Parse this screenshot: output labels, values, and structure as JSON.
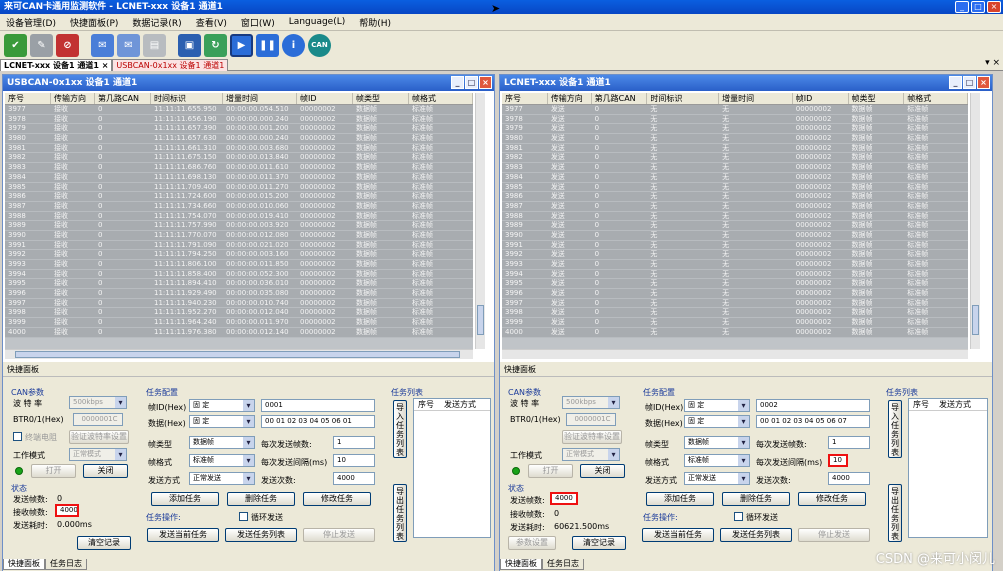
{
  "window": {
    "title": "来可CAN卡通用监测软件 - LCNET-xxx 设备1 通道1"
  },
  "menu": [
    "设备管理(D)",
    "快捷面板(P)",
    "数据记录(R)",
    "查看(V)",
    "窗口(W)",
    "Language(L)",
    "帮助(H)"
  ],
  "toolbar_icons": [
    "check-icon",
    "erase-icon",
    "stop-icon",
    "send-icon",
    "send-all-icon",
    "print-icon",
    "save-icon",
    "refresh-icon",
    "play-icon",
    "pause-icon",
    "info-icon",
    "can-logo-icon"
  ],
  "doc_tabs": [
    {
      "label": "LCNET-xxx 设备1 通道1"
    },
    {
      "label": "USBCAN-0x1xx 设备1 通道1"
    }
  ],
  "columns_left": [
    "序号",
    "传输方向",
    "第几路CAN",
    "时间标识",
    "增量时间",
    "帧ID",
    "帧类型",
    "帧格式"
  ],
  "columns_right": [
    "序号",
    "传输方向",
    "第几路CAN",
    "时间标识",
    "增量时间",
    "帧ID",
    "帧类型",
    "帧格式"
  ],
  "left": {
    "title": "USBCAN-0x1xx 设备1 通道1",
    "rows": [
      [
        "3977",
        "接收",
        "0",
        "11:11:11.655.950",
        "00:00:00.054.510",
        "00000002",
        "数据帧",
        "标准帧"
      ],
      [
        "3978",
        "接收",
        "0",
        "11:11:11.656.190",
        "00:00:00.000.240",
        "00000002",
        "数据帧",
        "标准帧"
      ],
      [
        "3979",
        "接收",
        "0",
        "11:11:11.657.390",
        "00:00:00.001.200",
        "00000002",
        "数据帧",
        "标准帧"
      ],
      [
        "3980",
        "接收",
        "0",
        "11:11:11.657.630",
        "00:00:00.000.240",
        "00000002",
        "数据帧",
        "标准帧"
      ],
      [
        "3981",
        "接收",
        "0",
        "11:11:11.661.310",
        "00:00:00.003.680",
        "00000002",
        "数据帧",
        "标准帧"
      ],
      [
        "3982",
        "接收",
        "0",
        "11:11:11.675.150",
        "00:00:00.013.840",
        "00000002",
        "数据帧",
        "标准帧"
      ],
      [
        "3983",
        "接收",
        "0",
        "11:11:11.686.760",
        "00:00:00.011.610",
        "00000002",
        "数据帧",
        "标准帧"
      ],
      [
        "3984",
        "接收",
        "0",
        "11:11:11.698.130",
        "00:00:00.011.370",
        "00000002",
        "数据帧",
        "标准帧"
      ],
      [
        "3985",
        "接收",
        "0",
        "11:11:11.709.400",
        "00:00:00.011.270",
        "00000002",
        "数据帧",
        "标准帧"
      ],
      [
        "3986",
        "接收",
        "0",
        "11:11:11.724.600",
        "00:00:00.015.200",
        "00000002",
        "数据帧",
        "标准帧"
      ],
      [
        "3987",
        "接收",
        "0",
        "11:11:11.734.660",
        "00:00:00.010.060",
        "00000002",
        "数据帧",
        "标准帧"
      ],
      [
        "3988",
        "接收",
        "0",
        "11:11:11.754.070",
        "00:00:00.019.410",
        "00000002",
        "数据帧",
        "标准帧"
      ],
      [
        "3989",
        "接收",
        "0",
        "11:11:11.757.990",
        "00:00:00.003.920",
        "00000002",
        "数据帧",
        "标准帧"
      ],
      [
        "3990",
        "接收",
        "0",
        "11:11:11.770.070",
        "00:00:00.012.080",
        "00000002",
        "数据帧",
        "标准帧"
      ],
      [
        "3991",
        "接收",
        "0",
        "11:11:11.791.090",
        "00:00:00.021.020",
        "00000002",
        "数据帧",
        "标准帧"
      ],
      [
        "3992",
        "接收",
        "0",
        "11:11:11.794.250",
        "00:00:00.003.160",
        "00000002",
        "数据帧",
        "标准帧"
      ],
      [
        "3993",
        "接收",
        "0",
        "11:11:11.806.100",
        "00:00:00.011.850",
        "00000002",
        "数据帧",
        "标准帧"
      ],
      [
        "3994",
        "接收",
        "0",
        "11:11:11.858.400",
        "00:00:00.052.300",
        "00000002",
        "数据帧",
        "标准帧"
      ],
      [
        "3995",
        "接收",
        "0",
        "11:11:11.894.410",
        "00:00:00.036.010",
        "00000002",
        "数据帧",
        "标准帧"
      ],
      [
        "3996",
        "接收",
        "0",
        "11:11:11.929.490",
        "00:00:00.035.080",
        "00000002",
        "数据帧",
        "标准帧"
      ],
      [
        "3997",
        "接收",
        "0",
        "11:11:11.940.230",
        "00:00:00.010.740",
        "00000002",
        "数据帧",
        "标准帧"
      ],
      [
        "3998",
        "接收",
        "0",
        "11:11:11.952.270",
        "00:00:00.012.040",
        "00000002",
        "数据帧",
        "标准帧"
      ],
      [
        "3999",
        "接收",
        "0",
        "11:11:11.964.240",
        "00:00:00.011.970",
        "00000002",
        "数据帧",
        "标准帧"
      ],
      [
        "4000",
        "接收",
        "0",
        "11:11:11.976.380",
        "00:00:00.012.140",
        "00000002",
        "数据帧",
        "标准帧"
      ]
    ],
    "quick_panel_label": "快捷面板",
    "can_params": {
      "group": "CAN参数",
      "baud_label": "波 特 率",
      "baud_value": "500kbps",
      "btr_label": "BTR0/1(Hex)",
      "btr_value": "0000001C",
      "terminal_label": "终端电阻",
      "verify_btn": "验证波特率设置",
      "mode_label": "工作模式",
      "mode_value": "正常模式",
      "open_btn": "打开",
      "close_btn": "关闭"
    },
    "status": {
      "group": "状态",
      "sent_label": "发送帧数:",
      "sent_value": "0",
      "recv_label": "接收帧数:",
      "recv_value": "4000",
      "time_label": "发送耗时:",
      "time_value": "0.000ms",
      "clear_btn": "清空记录"
    },
    "task_config": {
      "group": "任务配置",
      "frame_id_label": "帧ID(Hex)",
      "frame_id_mode": "固  定",
      "frame_id_value": "0001",
      "data_label": "数据(Hex)",
      "data_mode": "固  定",
      "data_value": "00 01 02 03 04 05 06 01",
      "type_label": "帧类型",
      "type_value": "数据帧",
      "per_label": "每次发送帧数:",
      "per_value": "1",
      "format_label": "帧格式",
      "format_value": "标准帧",
      "interval_label": "每次发送间隔(ms)",
      "interval_value": "10",
      "send_mode_label": "发送方式",
      "send_mode_value": "正常发送",
      "times_label": "发送次数:",
      "times_value": "4000",
      "add_btn": "添加任务",
      "del_btn": "删除任务",
      "mod_btn": "修改任务"
    },
    "task_ops": {
      "group": "任务操作:",
      "loop_label": "循环发送",
      "send_cur_btn": "发送当前任务",
      "send_list_btn": "发送任务列表",
      "stop_btn": "停止发送"
    },
    "task_list": {
      "group": "任务列表",
      "import_btn": "导入任务列表",
      "export_btn": "导出任务列表",
      "col_no": "序号",
      "col_mode": "发送方式"
    },
    "bottom_tabs": [
      "快捷面板",
      "任务日志"
    ]
  },
  "right": {
    "title": "LCNET-xxx 设备1 通道1",
    "rows": [
      [
        "3977",
        "发送",
        "0",
        "无",
        "无",
        "00000002",
        "数据帧",
        "标准帧"
      ],
      [
        "3978",
        "发送",
        "0",
        "无",
        "无",
        "00000002",
        "数据帧",
        "标准帧"
      ],
      [
        "3979",
        "发送",
        "0",
        "无",
        "无",
        "00000002",
        "数据帧",
        "标准帧"
      ],
      [
        "3980",
        "发送",
        "0",
        "无",
        "无",
        "00000002",
        "数据帧",
        "标准帧"
      ],
      [
        "3981",
        "发送",
        "0",
        "无",
        "无",
        "00000002",
        "数据帧",
        "标准帧"
      ],
      [
        "3982",
        "发送",
        "0",
        "无",
        "无",
        "00000002",
        "数据帧",
        "标准帧"
      ],
      [
        "3983",
        "发送",
        "0",
        "无",
        "无",
        "00000002",
        "数据帧",
        "标准帧"
      ],
      [
        "3984",
        "发送",
        "0",
        "无",
        "无",
        "00000002",
        "数据帧",
        "标准帧"
      ],
      [
        "3985",
        "发送",
        "0",
        "无",
        "无",
        "00000002",
        "数据帧",
        "标准帧"
      ],
      [
        "3986",
        "发送",
        "0",
        "无",
        "无",
        "00000002",
        "数据帧",
        "标准帧"
      ],
      [
        "3987",
        "发送",
        "0",
        "无",
        "无",
        "00000002",
        "数据帧",
        "标准帧"
      ],
      [
        "3988",
        "发送",
        "0",
        "无",
        "无",
        "00000002",
        "数据帧",
        "标准帧"
      ],
      [
        "3989",
        "发送",
        "0",
        "无",
        "无",
        "00000002",
        "数据帧",
        "标准帧"
      ],
      [
        "3990",
        "发送",
        "0",
        "无",
        "无",
        "00000002",
        "数据帧",
        "标准帧"
      ],
      [
        "3991",
        "发送",
        "0",
        "无",
        "无",
        "00000002",
        "数据帧",
        "标准帧"
      ],
      [
        "3992",
        "发送",
        "0",
        "无",
        "无",
        "00000002",
        "数据帧",
        "标准帧"
      ],
      [
        "3993",
        "发送",
        "0",
        "无",
        "无",
        "00000002",
        "数据帧",
        "标准帧"
      ],
      [
        "3994",
        "发送",
        "0",
        "无",
        "无",
        "00000002",
        "数据帧",
        "标准帧"
      ],
      [
        "3995",
        "发送",
        "0",
        "无",
        "无",
        "00000002",
        "数据帧",
        "标准帧"
      ],
      [
        "3996",
        "发送",
        "0",
        "无",
        "无",
        "00000002",
        "数据帧",
        "标准帧"
      ],
      [
        "3997",
        "发送",
        "0",
        "无",
        "无",
        "00000002",
        "数据帧",
        "标准帧"
      ],
      [
        "3998",
        "发送",
        "0",
        "无",
        "无",
        "00000002",
        "数据帧",
        "标准帧"
      ],
      [
        "3999",
        "发送",
        "0",
        "无",
        "无",
        "00000002",
        "数据帧",
        "标准帧"
      ],
      [
        "4000",
        "发送",
        "0",
        "无",
        "无",
        "00000002",
        "数据帧",
        "标准帧"
      ]
    ],
    "quick_panel_label": "快捷面板",
    "can_params": {
      "group": "CAN参数",
      "baud_label": "波 特 率",
      "baud_value": "500kbps",
      "btr_label": "BTR0/1(Hex)",
      "btr_value": "0000001C",
      "verify_btn": "验证波特率设置",
      "mode_label": "工作模式",
      "mode_value": "正常模式",
      "open_btn": "打开",
      "close_btn": "关闭"
    },
    "status": {
      "group": "状态",
      "sent_label": "发送帧数:",
      "sent_value": "4000",
      "recv_label": "接收帧数:",
      "recv_value": "0",
      "time_label": "发送耗时:",
      "time_value": "60621.500ms",
      "param_btn": "参数设置",
      "clear_btn": "清空记录"
    },
    "task_config": {
      "group": "任务配置",
      "frame_id_label": "帧ID(Hex)",
      "frame_id_mode": "固  定",
      "frame_id_value": "0002",
      "data_label": "数据(Hex)",
      "data_mode": "固  定",
      "data_value": "00 01 02 03 04 05 06 07",
      "type_label": "帧类型",
      "type_value": "数据帧",
      "per_label": "每次发送帧数:",
      "per_value": "1",
      "format_label": "帧格式",
      "format_value": "标准帧",
      "interval_label": "每次发送间隔(ms)",
      "interval_value": "10",
      "send_mode_label": "发送方式",
      "send_mode_value": "正常发送",
      "times_label": "发送次数:",
      "times_value": "4000",
      "add_btn": "添加任务",
      "del_btn": "删除任务",
      "mod_btn": "修改任务"
    },
    "task_ops": {
      "group": "任务操作:",
      "loop_label": "循环发送",
      "send_cur_btn": "发送当前任务",
      "send_list_btn": "发送任务列表",
      "stop_btn": "停止发送"
    },
    "task_list": {
      "group": "任务列表",
      "import_btn": "导入任务列表",
      "export_btn": "导出任务列表",
      "col_no": "序号",
      "col_mode": "发送方式"
    },
    "bottom_tabs": [
      "快捷面板",
      "任务日志"
    ]
  },
  "watermark": "CSDN @来可小闵儿",
  "colors": {
    "accent": "#0a5fe0",
    "grid_row": "#a8acb0",
    "highlight": "#e11111",
    "led": "#19a319"
  }
}
